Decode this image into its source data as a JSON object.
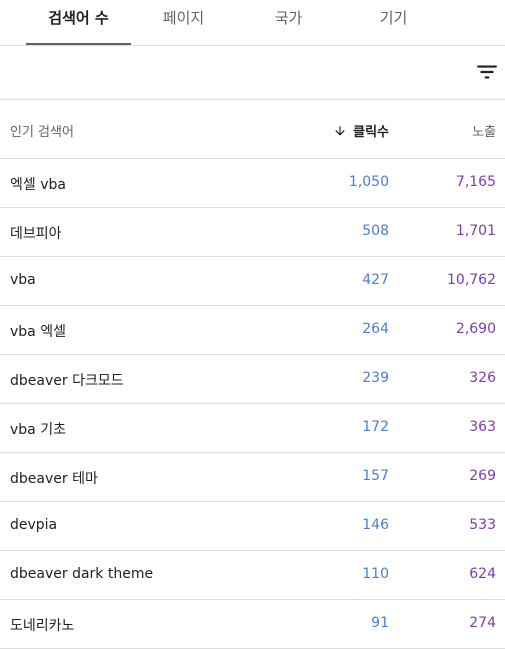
{
  "tabs": [
    {
      "label": "검색어 수"
    },
    {
      "label": "페이지"
    },
    {
      "label": "국가"
    },
    {
      "label": "기기"
    }
  ],
  "filter_icon": "filter-icon",
  "table": {
    "headers": {
      "query": "인기 검색어",
      "clicks": "클릭수",
      "impressions": "노출"
    },
    "sort_icon": "arrow-down-icon",
    "rows": [
      {
        "query": "엑셀 vba",
        "clicks": "1,050",
        "impressions": "7,165"
      },
      {
        "query": "데브피아",
        "clicks": "508",
        "impressions": "1,701"
      },
      {
        "query": "vba",
        "clicks": "427",
        "impressions": "10,762"
      },
      {
        "query": "vba 엑셀",
        "clicks": "264",
        "impressions": "2,690"
      },
      {
        "query": "dbeaver 다크모드",
        "clicks": "239",
        "impressions": "326"
      },
      {
        "query": "vba 기초",
        "clicks": "172",
        "impressions": "363"
      },
      {
        "query": "dbeaver 테마",
        "clicks": "157",
        "impressions": "269"
      },
      {
        "query": "devpia",
        "clicks": "146",
        "impressions": "533"
      },
      {
        "query": "dbeaver dark theme",
        "clicks": "110",
        "impressions": "624"
      },
      {
        "query": "도네리카노",
        "clicks": "91",
        "impressions": "274"
      }
    ]
  },
  "colors": {
    "clicks": "#4a7fd0",
    "impressions": "#7b3fa8",
    "divider": "#dadce0"
  }
}
